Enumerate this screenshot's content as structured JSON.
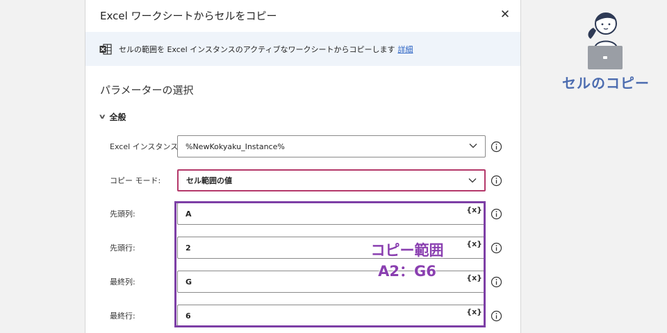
{
  "dialog": {
    "title": "Excel ワークシートからセルをコピー",
    "close_glyph": "✕",
    "info_text": "セルの範囲を Excel インスタンスのアクティブなワークシートからコピーします",
    "info_link": "詳細",
    "section_title": "パラメーターの選択",
    "group_label": "全般",
    "fields": [
      {
        "label": "Excel インスタンス:",
        "value": "%NewKokyaku_Instance%",
        "kind": "dropdown"
      },
      {
        "label": "コピー モード:",
        "value": "セル範囲の値",
        "kind": "dropdown"
      },
      {
        "label": "先頭列:",
        "value": "A",
        "kind": "text",
        "var_label": "{x}"
      },
      {
        "label": "先頭行:",
        "value": "2",
        "kind": "text",
        "var_label": "{x}"
      },
      {
        "label": "最終列:",
        "value": "G",
        "kind": "text",
        "var_label": "{x}"
      },
      {
        "label": "最終行:",
        "value": "6",
        "kind": "text",
        "var_label": "{x}"
      }
    ]
  },
  "annotation": {
    "line1": "コピー範囲",
    "line2": "A2：G6"
  },
  "side": {
    "caption": "セルのコピー"
  },
  "colors": {
    "pink_highlight": "#b4386a",
    "purple_box": "#7d3fa6",
    "annotation_text": "#8a3fb0",
    "caption_text": "#4d6db0",
    "link": "#2b63c4"
  },
  "icons": [
    "excel-icon",
    "close-icon",
    "chevron-down-icon",
    "info-icon",
    "variable-icon",
    "person-laptop-illustration"
  ]
}
